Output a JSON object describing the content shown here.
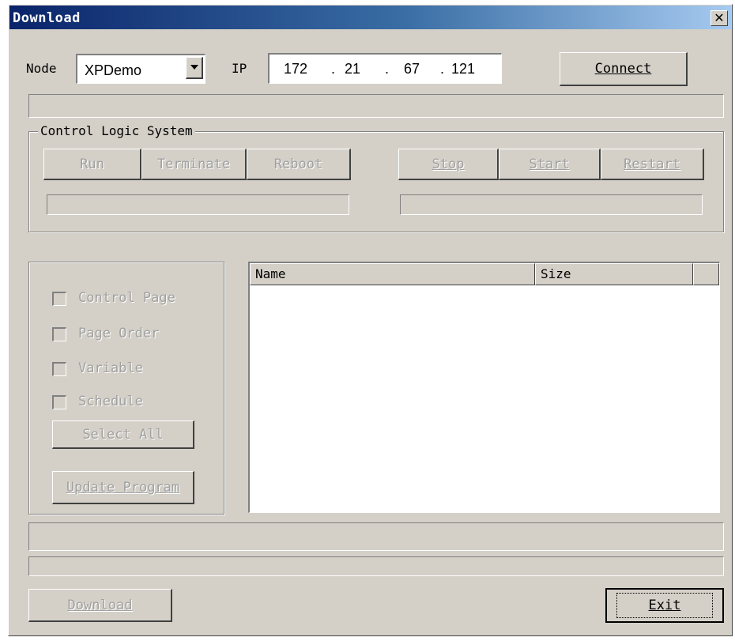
{
  "window": {
    "title": "Download",
    "close_glyph": "✕"
  },
  "node": {
    "label": "Node",
    "value": "XPDemo"
  },
  "ip": {
    "label": "IP",
    "octets": [
      "172",
      "21",
      "67",
      "121"
    ],
    "separator": "."
  },
  "connect_button": {
    "label": "Connect"
  },
  "control_group": {
    "title": "Control Logic System",
    "left_buttons": [
      "Run",
      "Terminate",
      "Reboot"
    ],
    "right_buttons": [
      "Stop",
      "Start",
      "Restart"
    ]
  },
  "options": {
    "checkboxes": [
      "Control Page",
      "Page Order",
      "Variable",
      "Schedule"
    ],
    "select_all": "Select All",
    "update_program": "Update Program"
  },
  "file_list": {
    "columns": [
      "Name",
      "Size"
    ],
    "rows": []
  },
  "footer": {
    "download": "Download",
    "exit": "Exit"
  }
}
